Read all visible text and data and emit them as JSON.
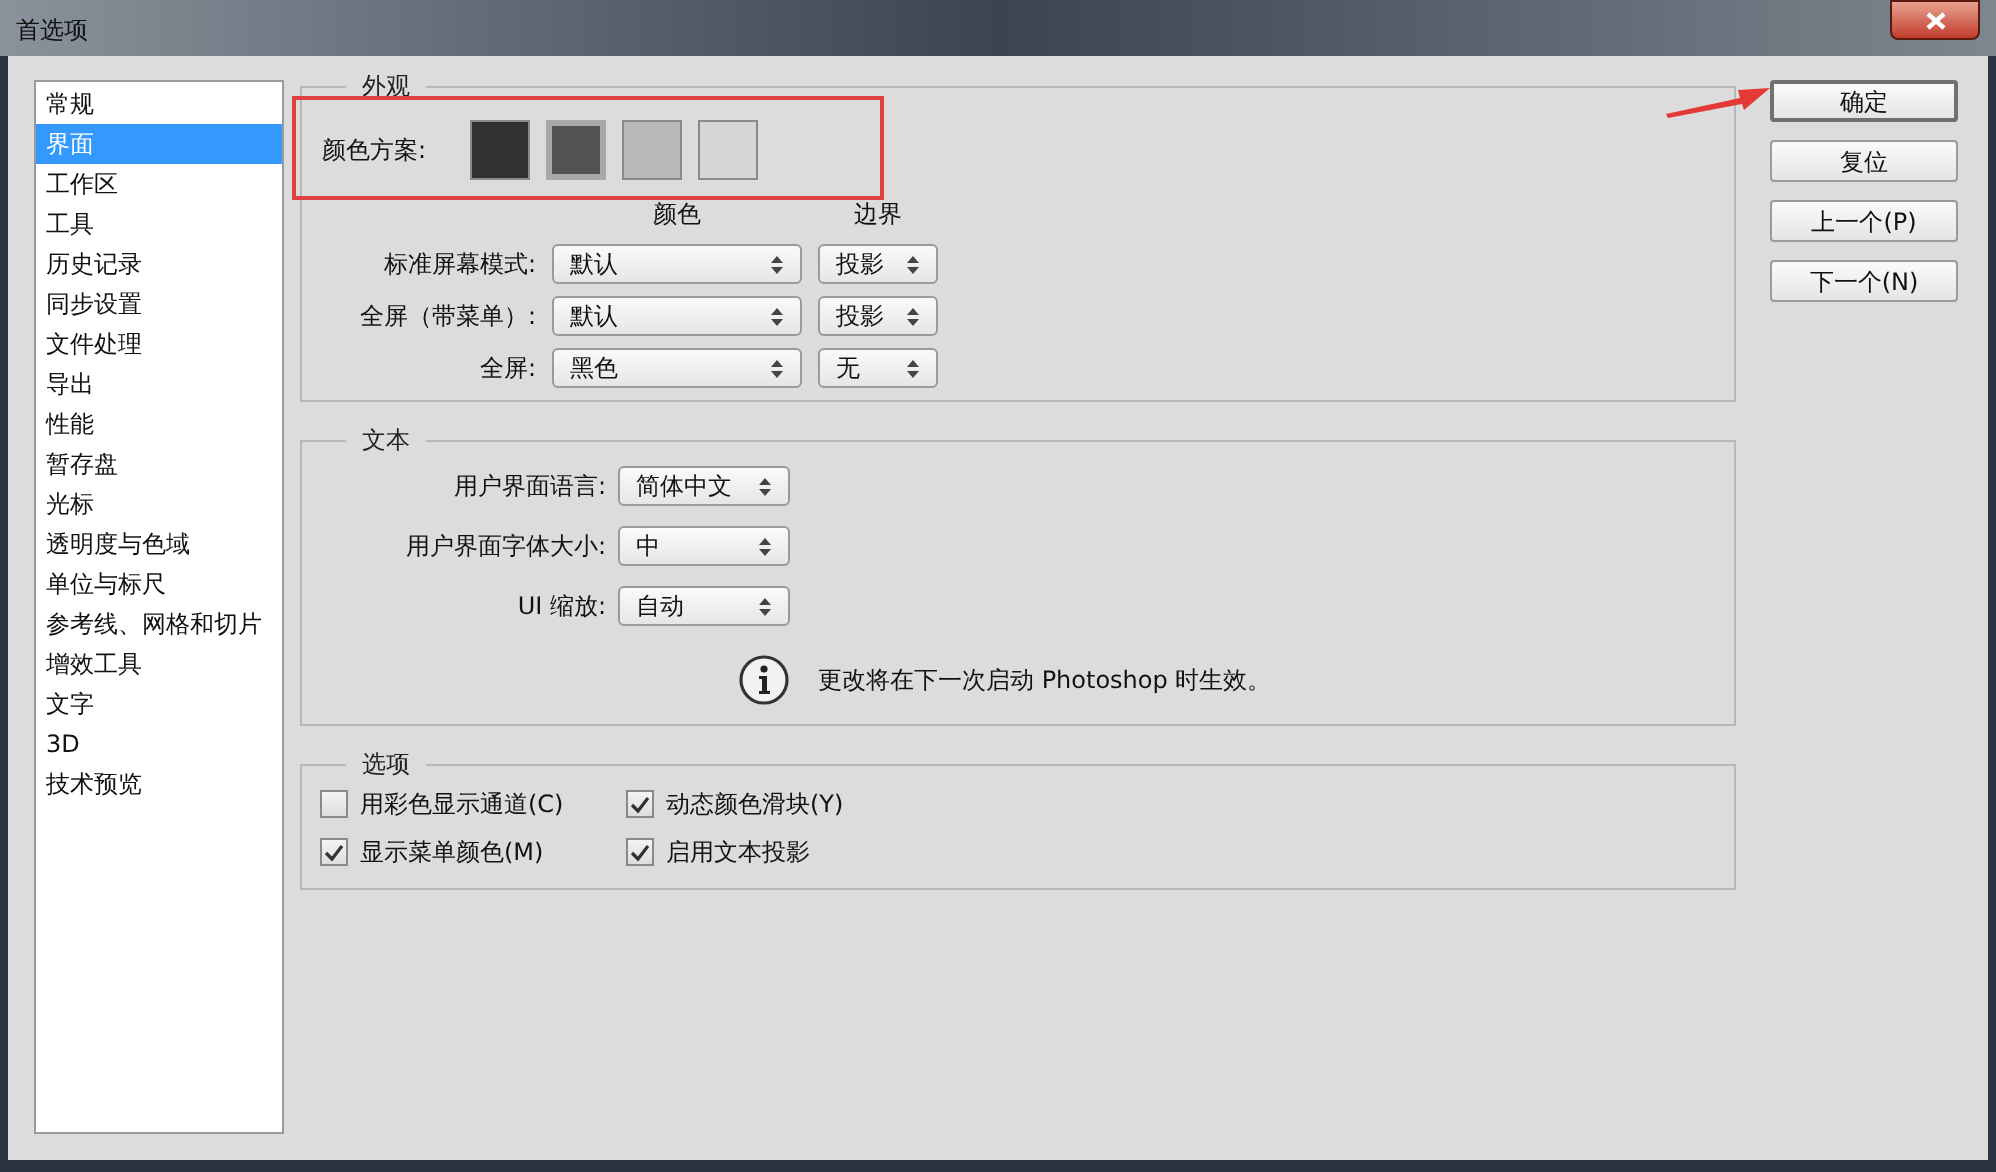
{
  "window": {
    "title": "首选项"
  },
  "sidebar": {
    "items": [
      {
        "label": "常规",
        "selected": false
      },
      {
        "label": "界面",
        "selected": true
      },
      {
        "label": "工作区",
        "selected": false
      },
      {
        "label": "工具",
        "selected": false
      },
      {
        "label": "历史记录",
        "selected": false
      },
      {
        "label": "同步设置",
        "selected": false
      },
      {
        "label": "文件处理",
        "selected": false
      },
      {
        "label": "导出",
        "selected": false
      },
      {
        "label": "性能",
        "selected": false
      },
      {
        "label": "暂存盘",
        "selected": false
      },
      {
        "label": "光标",
        "selected": false
      },
      {
        "label": "透明度与色域",
        "selected": false
      },
      {
        "label": "单位与标尺",
        "selected": false
      },
      {
        "label": "参考线、网格和切片",
        "selected": false
      },
      {
        "label": "增效工具",
        "selected": false
      },
      {
        "label": "文字",
        "selected": false
      },
      {
        "label": "3D",
        "selected": false
      },
      {
        "label": "技术预览",
        "selected": false
      }
    ]
  },
  "appearance": {
    "title": "外观",
    "color_scheme": {
      "label": "颜色方案:",
      "swatches": [
        {
          "color": "#323232",
          "selected": false
        },
        {
          "color": "#535353",
          "selected": true
        },
        {
          "color": "#b8b8b8",
          "selected": false
        },
        {
          "color": "#d6d6d6",
          "selected": false
        }
      ]
    },
    "column_headers": [
      "颜色",
      "边界"
    ],
    "rows": [
      {
        "label": "标准屏幕模式:",
        "color_value": "默认",
        "border_value": "投影"
      },
      {
        "label": "全屏（带菜单）:",
        "color_value": "默认",
        "border_value": "投影"
      },
      {
        "label": "全屏:",
        "color_value": "黑色",
        "border_value": "无"
      }
    ]
  },
  "text": {
    "title": "文本",
    "rows": [
      {
        "label": "用户界面语言:",
        "value": "简体中文"
      },
      {
        "label": "用户界面字体大小:",
        "value": "中"
      },
      {
        "label": "UI 缩放:",
        "value": "自动"
      }
    ],
    "notice": "更改将在下一次启动 Photoshop 时生效。"
  },
  "options": {
    "title": "选项",
    "checkboxes": [
      {
        "label": "用彩色显示通道(C)",
        "checked": false
      },
      {
        "label": "动态颜色滑块(Y)",
        "checked": true
      },
      {
        "label": "显示菜单颜色(M)",
        "checked": true
      },
      {
        "label": "启用文本投影",
        "checked": true
      }
    ]
  },
  "buttons": [
    {
      "label": "确定",
      "default": true
    },
    {
      "label": "复位",
      "default": false
    },
    {
      "label": "上一个(P)",
      "default": false
    },
    {
      "label": "下一个(N)",
      "default": false
    }
  ]
}
